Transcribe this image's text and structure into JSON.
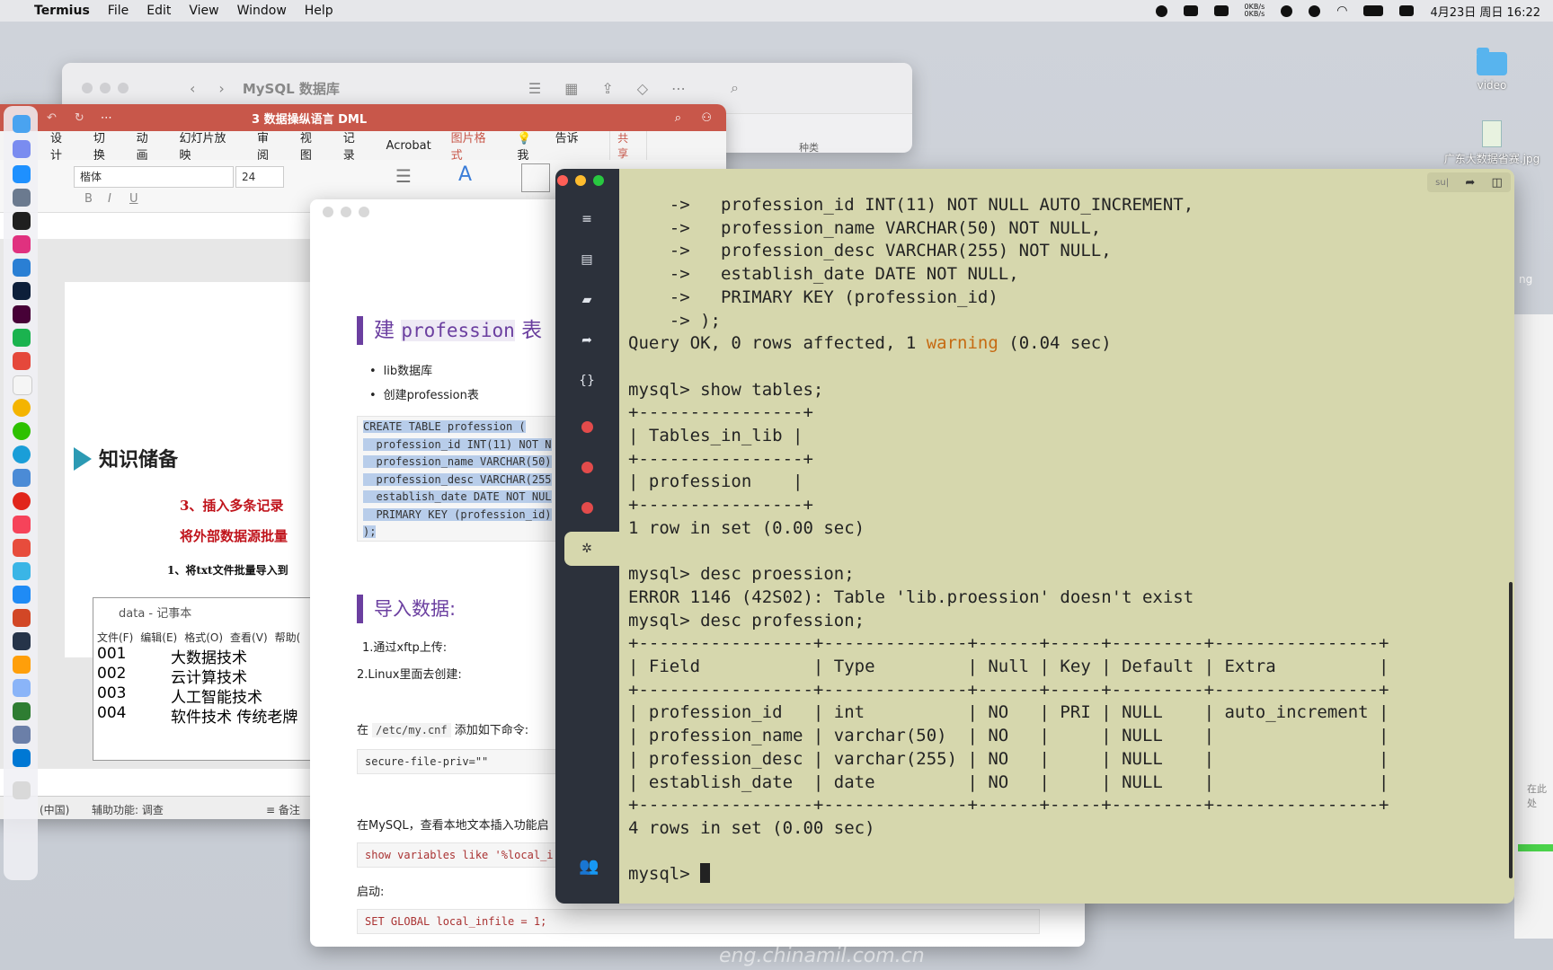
{
  "menubar": {
    "app_name": "Termius",
    "menus": [
      "File",
      "Edit",
      "View",
      "Window",
      "Help"
    ],
    "net_up": "0KB/s",
    "net_down": "0KB/s",
    "datetime": "4月23日 周日 16:22"
  },
  "desktop": {
    "items": [
      {
        "label": "video",
        "icon": "folder-icon"
      },
      {
        "label": "广东大数据省赛.jpg",
        "icon": "image-file-icon"
      }
    ],
    "right_fragment_1": "ng",
    "right_fragment_2": "在此处"
  },
  "finder": {
    "title": "MySQL 数据库",
    "column_kind": "种类"
  },
  "powerpoint": {
    "title": "3 数据操纵语言 DML",
    "tabs": [
      "设计",
      "切换",
      "动画",
      "幻灯片放映",
      "审阅",
      "视图",
      "记录",
      "Acrobat",
      "图片格式",
      "告诉我"
    ],
    "share": "共享",
    "font_name": "楷体",
    "font_size": "24",
    "slide_heading": "知识储备",
    "slide_red_1": "3、插入多条记录",
    "slide_red_2": "将外部数据源批量",
    "slide_sub": "1、将txt文件批量导入到",
    "notepad": {
      "title": "data - 记事本",
      "menus": [
        "文件(F)",
        "编辑(E)",
        "格式(O)",
        "查看(V)",
        "帮助("
      ],
      "rows": [
        {
          "id": "001",
          "name": "大数据技术"
        },
        {
          "id": "002",
          "name": "云计算技术"
        },
        {
          "id": "003",
          "name": "人工智能技术"
        },
        {
          "id": "004",
          "name": "软件技术  传统老牌"
        }
      ]
    },
    "status_lang": "(中国)",
    "status_access": "辅助功能: 调查",
    "status_notes": "备注"
  },
  "doc": {
    "h1_prefix": "建",
    "h1_code": "profession",
    "h1_suffix": "表",
    "bullets": [
      "lib数据库",
      "创建profession表"
    ],
    "sql_lines": [
      "CREATE TABLE profession (",
      "  profession_id INT(11) NOT N",
      "  profession_name VARCHAR(50)",
      "  profession_desc VARCHAR(255",
      "  establish_date DATE NOT NUL",
      "  PRIMARY KEY (profession_id)",
      ");"
    ],
    "h2": "导入数据:",
    "step1": "1.通过xftp上传:",
    "step2": "2.Linux里面去创建:",
    "mycnf_before": "在",
    "mycnf_code": "/etc/my.cnf",
    "mycnf_after": "添加如下命令:",
    "code_priv": "secure-file-priv=\"\"",
    "mysql_check": "在MySQL，查看本地文本插入功能启",
    "code_show": "show variables like '%local_i",
    "start_label": "启动:",
    "code_set": "SET GLOBAL local_infile = 1;"
  },
  "terminal": {
    "top_btn_label": "su|",
    "lines": [
      "    ->   profession_id INT(11) NOT NULL AUTO_INCREMENT,",
      "    ->   profession_name VARCHAR(50) NOT NULL,",
      "    ->   profession_desc VARCHAR(255) NOT NULL,",
      "    ->   establish_date DATE NOT NULL,",
      "    ->   PRIMARY KEY (profession_id)",
      "    -> );"
    ],
    "query_ok_before": "Query OK, 0 rows affected, 1 ",
    "query_ok_warning": "warning",
    "query_ok_after": " (0.04 sec)",
    "lines2": [
      "",
      "mysql> show tables;",
      "+----------------+",
      "| Tables_in_lib |",
      "+----------------+",
      "| profession    |",
      "+----------------+",
      "1 row in set (0.00 sec)",
      "",
      "mysql> desc proession;",
      "ERROR 1146 (42S02): Table 'lib.proession' doesn't exist",
      "mysql> desc profession;",
      "+-----------------+--------------+------+-----+---------+----------------+",
      "| Field           | Type         | Null | Key | Default | Extra          |",
      "+-----------------+--------------+------+-----+---------+----------------+",
      "| profession_id   | int          | NO   | PRI | NULL    | auto_increment |",
      "| profession_name | varchar(50)  | NO   |     | NULL    |                |",
      "| profession_desc | varchar(255) | NO   |     | NULL    |                |",
      "| establish_date  | date         | NO   |     | NULL    |                |",
      "+-----------------+--------------+------+-----+---------+----------------+",
      "4 rows in set (0.00 sec)",
      ""
    ],
    "prompt": "mysql> "
  },
  "watermark": "eng.chinamil.com.cn",
  "colors": {
    "terminal_bg": "#d6d7ad",
    "terminal_sidebar": "#2c313b",
    "ppt_red": "#c8574a",
    "warning_orange": "#c66a12"
  }
}
